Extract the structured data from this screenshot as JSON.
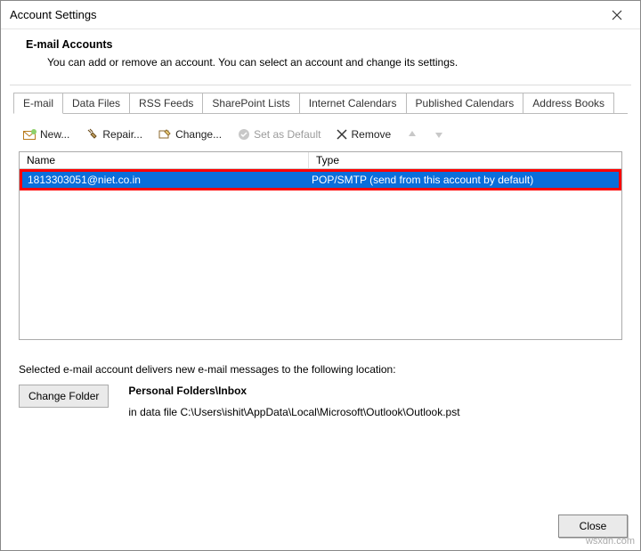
{
  "window": {
    "title": "Account Settings"
  },
  "header": {
    "heading": "E-mail Accounts",
    "sub": "You can add or remove an account. You can select an account and change its settings."
  },
  "tabs": [
    {
      "label": "E-mail",
      "active": true
    },
    {
      "label": "Data Files"
    },
    {
      "label": "RSS Feeds"
    },
    {
      "label": "SharePoint Lists"
    },
    {
      "label": "Internet Calendars"
    },
    {
      "label": "Published Calendars"
    },
    {
      "label": "Address Books"
    }
  ],
  "toolbar": {
    "new": "New...",
    "repair": "Repair...",
    "change": "Change...",
    "set_default": "Set as Default",
    "remove": "Remove"
  },
  "table": {
    "headers": {
      "name": "Name",
      "type": "Type"
    },
    "rows": [
      {
        "name": "1813303051@niet.co.in",
        "type": "POP/SMTP (send from this account by default)",
        "selected": true
      }
    ]
  },
  "delivery": {
    "text": "Selected e-mail account delivers new e-mail messages to the following location:",
    "change_folder": "Change Folder",
    "folder": "Personal Folders\\Inbox",
    "path_prefix": "in data file ",
    "path": "C:\\Users\\ishit\\AppData\\Local\\Microsoft\\Outlook\\Outlook.pst"
  },
  "footer": {
    "close": "Close"
  },
  "watermark": "wsxdn.com"
}
